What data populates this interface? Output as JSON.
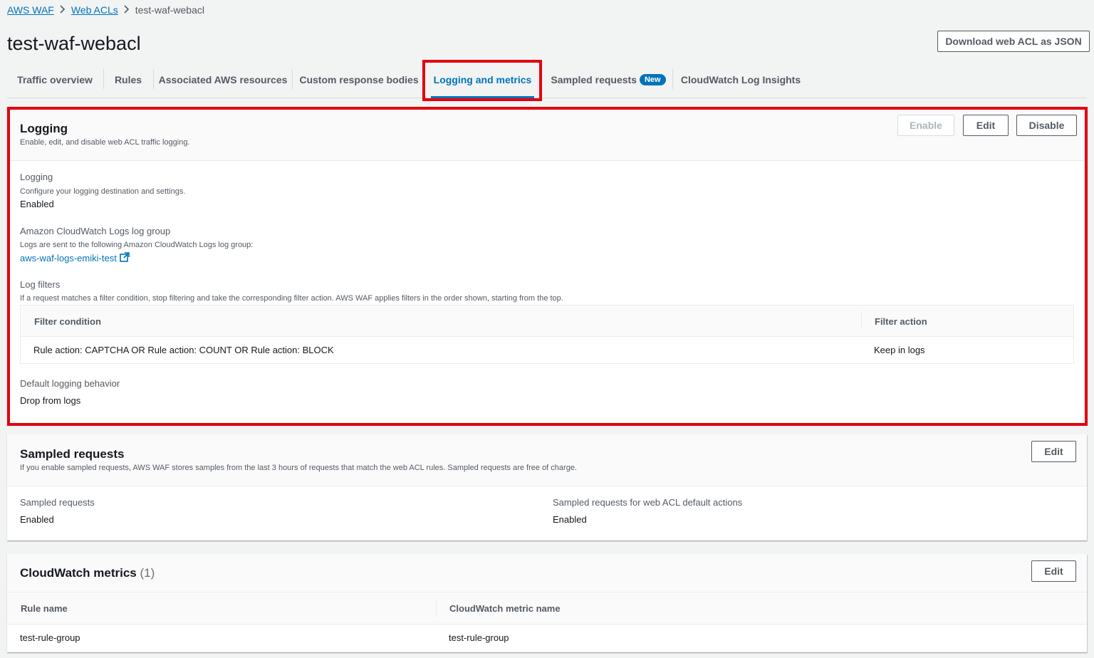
{
  "breadcrumb": {
    "items": [
      "AWS WAF",
      "Web ACLs"
    ],
    "current": "test-waf-webacl"
  },
  "page": {
    "title": "test-waf-webacl",
    "download_label": "Download web ACL as JSON"
  },
  "tabs": [
    {
      "label": "Traffic overview"
    },
    {
      "label": "Rules"
    },
    {
      "label": "Associated AWS resources"
    },
    {
      "label": "Custom response bodies"
    },
    {
      "label": "Logging and metrics",
      "active": true
    },
    {
      "label": "Sampled requests",
      "badge": "New"
    },
    {
      "label": "CloudWatch Log Insights"
    }
  ],
  "logging_panel": {
    "title": "Logging",
    "description": "Enable, edit, and disable web ACL traffic logging.",
    "enable_label": "Enable",
    "edit_label": "Edit",
    "disable_label": "Disable",
    "logging": {
      "label": "Logging",
      "description": "Configure your logging destination and settings.",
      "value": "Enabled"
    },
    "log_group": {
      "label": "Amazon CloudWatch Logs log group",
      "description": "Logs are sent to the following Amazon CloudWatch Logs log group:",
      "link": "aws-waf-logs-emiki-test"
    },
    "log_filters": {
      "label": "Log filters",
      "description": "If a request matches a filter condition, stop filtering and take the corresponding filter action. AWS WAF applies filters in the order shown, starting from the top.",
      "columns": [
        "Filter condition",
        "Filter action"
      ],
      "rows": [
        [
          "Rule action: CAPTCHA OR Rule action: COUNT OR Rule action: BLOCK",
          "Keep in logs"
        ]
      ]
    },
    "default_behavior": {
      "label": "Default logging behavior",
      "value": "Drop from logs"
    }
  },
  "sampled_panel": {
    "title": "Sampled requests",
    "description": "If you enable sampled requests, AWS WAF stores samples from the last 3 hours of requests that match the web ACL rules. Sampled requests are free of charge.",
    "edit_label": "Edit",
    "sampled": {
      "label": "Sampled requests",
      "value": "Enabled"
    },
    "default_actions": {
      "label": "Sampled requests for web ACL default actions",
      "value": "Enabled"
    }
  },
  "metrics_panel": {
    "title": "CloudWatch metrics",
    "count": "(1)",
    "edit_label": "Edit",
    "columns": [
      "Rule name",
      "CloudWatch metric name"
    ],
    "rows": [
      [
        "test-rule-group",
        "test-rule-group"
      ]
    ]
  },
  "colors": {
    "link": "#0073bb",
    "highlight": "#e3000f",
    "badge": "#0073bb"
  },
  "icons": {
    "breadcrumb_separator": "chevron-right-icon",
    "external_link": "external-link-icon"
  }
}
